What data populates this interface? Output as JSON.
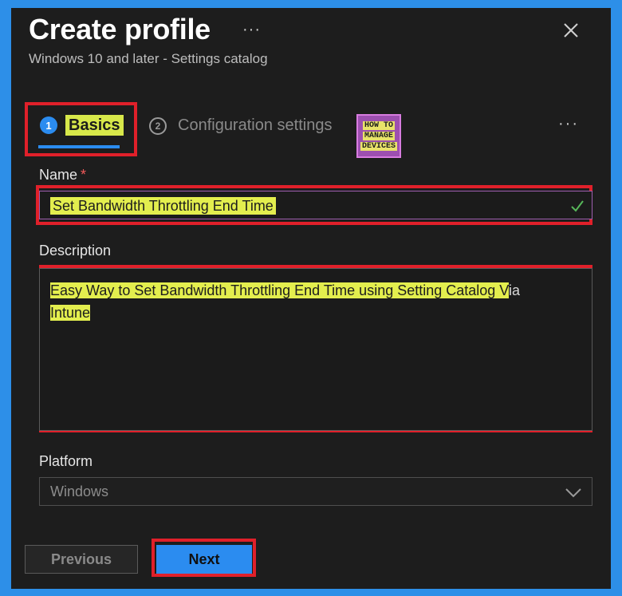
{
  "header": {
    "title": "Create profile",
    "more_label": "···",
    "subtitle": "Windows 10 and later - Settings catalog",
    "close_icon": "close-icon"
  },
  "tabs": [
    {
      "number": "1",
      "label": "Basics",
      "active": true
    },
    {
      "number": "2",
      "label": "Configuration settings",
      "active": false
    }
  ],
  "tabs_more_label": "···",
  "logo": {
    "line1": "HOW TO",
    "line2": "MANAGE",
    "line3": "DEVICES"
  },
  "form": {
    "name": {
      "label": "Name",
      "required_mark": "*",
      "value": "Set Bandwidth Throttling End Time"
    },
    "description": {
      "label": "Description",
      "value_highlighted": "Easy Way to Set Bandwidth Throttling End Time using Setting Catalog V",
      "value_rest": "ia",
      "value_line2": "Intune"
    },
    "platform": {
      "label": "Platform",
      "value": "Windows"
    }
  },
  "footer": {
    "previous_label": "Previous",
    "next_label": "Next"
  },
  "colors": {
    "background_frame": "#2d8fe8",
    "panel": "#1d1d1d",
    "accent": "#2b8cf0",
    "highlight": "#e3ee4e",
    "annotation_red": "#e0202a"
  }
}
